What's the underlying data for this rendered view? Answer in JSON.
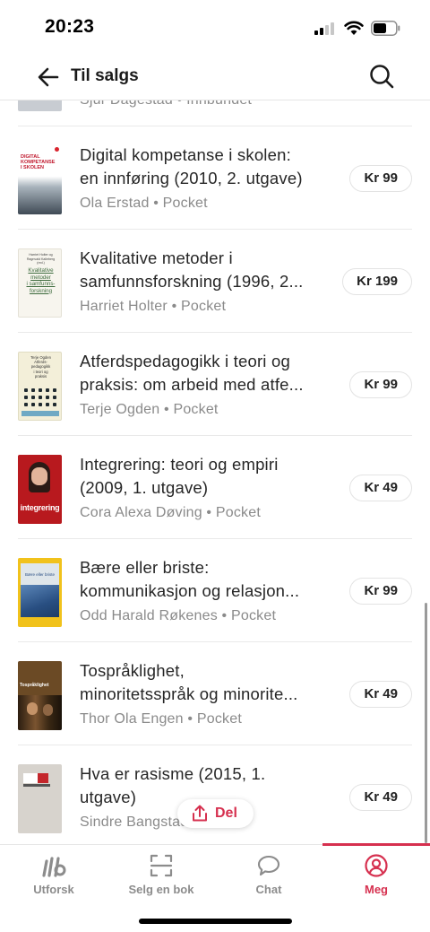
{
  "status_bar": {
    "time": "20:23"
  },
  "header": {
    "title": "Til salgs",
    "back_icon": "arrow-left-icon",
    "search_icon": "search-icon"
  },
  "partial_top": {
    "meta": "Sjur Dagestad • Innbundet"
  },
  "items": [
    {
      "title_line1": "Digital kompetanse i skolen:",
      "title_line2": "en innføring (2010, 2. utgave)",
      "meta": "Ola Erstad • Pocket",
      "price": "Kr 99"
    },
    {
      "title_line1": "Kvalitative metoder i",
      "title_line2": "samfunnsforskning (1996, 2...",
      "meta": "Harriet Holter • Pocket",
      "price": "Kr 199"
    },
    {
      "title_line1": "Atferdspedagogikk i teori og",
      "title_line2": "praksis: om arbeid med atfe...",
      "meta": "Terje Ogden • Pocket",
      "price": "Kr 99"
    },
    {
      "title_line1": "Integrering: teori og empiri",
      "title_line2": "(2009, 1. utgave)",
      "meta": "Cora Alexa Døving • Pocket",
      "price": "Kr 49"
    },
    {
      "title_line1": "Bære eller briste:",
      "title_line2": "kommunikasjon og relasjon...",
      "meta": "Odd Harald Røkenes • Pocket",
      "price": "Kr 99"
    },
    {
      "title_line1": "Tospråklighet,",
      "title_line2": "minoritetsspråk og minorite...",
      "meta": "Thor Ola Engen • Pocket",
      "price": "Kr 49"
    },
    {
      "title_line1": "Hva er rasisme (2015, 1.",
      "title_line2": "utgave)",
      "meta": "Sindre Bangstad • Pocket",
      "price": "Kr 49"
    }
  ],
  "covers": {
    "c0": {
      "line1": "DIGITAL",
      "line2": "KOMPETANSE",
      "line3": "I SKOLEN"
    },
    "c1": {
      "line1": "Harriet Holter og",
      "line2": "Ragnvald Kalleberg",
      "line3": "(red.)",
      "line4": "Kvalitative",
      "line5": "metoder",
      "line6": "i samfunns-",
      "line7": "forskning"
    },
    "c2": {
      "line1": "Terje Ogden",
      "line2": "Atferds-",
      "line3": "pedagogikk",
      "line4": "i teori og",
      "line5": "praksis"
    },
    "c3": {
      "line1": "integrering"
    },
    "c4": {
      "line1": "Bære eller briste"
    },
    "c5": {
      "line1": "Tospråklighet"
    }
  },
  "share": {
    "label": "Del",
    "icon": "share-icon"
  },
  "tabs": [
    {
      "label": "Utforsk",
      "icon": "logo-lb-icon"
    },
    {
      "label": "Selg en bok",
      "icon": "scan-icon"
    },
    {
      "label": "Chat",
      "icon": "chat-bubble-icon"
    },
    {
      "label": "Meg",
      "icon": "profile-icon"
    }
  ],
  "colors": {
    "accent": "#d6304f",
    "text": "#262626",
    "meta": "#8a8a8a",
    "divider": "#e9e9e9"
  }
}
